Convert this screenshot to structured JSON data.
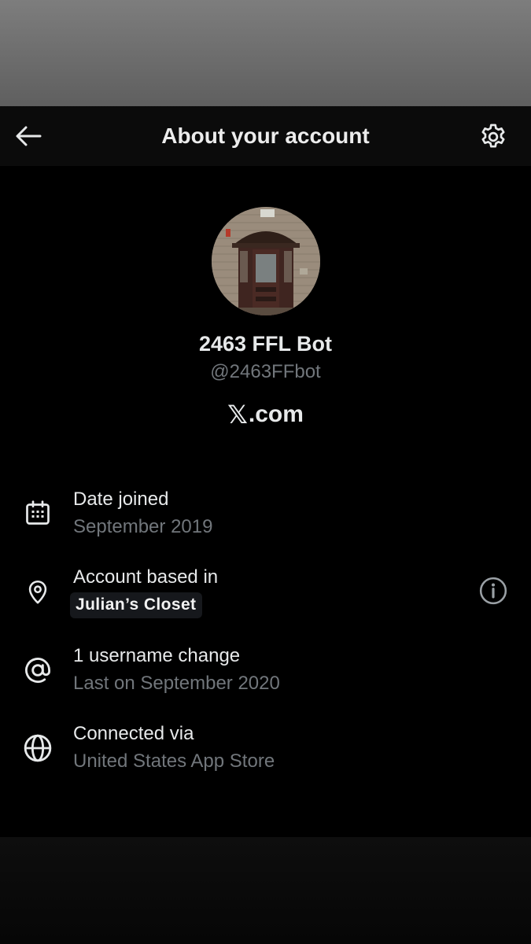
{
  "header": {
    "title": "About your account",
    "back_icon": "arrow-left-icon",
    "settings_icon": "gear-icon"
  },
  "profile": {
    "display_name": "2463 FFL Bot",
    "handle": "@2463FFbot",
    "site_suffix": ".com",
    "site_logo": "x-logo-icon"
  },
  "details": {
    "date_joined": {
      "label": "Date joined",
      "value": "September 2019",
      "icon": "calendar-icon"
    },
    "account_based": {
      "label": "Account based in",
      "value": "Julian’s Closet",
      "icon": "location-pin-icon",
      "info_icon": "info-icon"
    },
    "username_change": {
      "label": "1 username change",
      "value": "Last on September 2020",
      "icon": "at-sign-icon"
    },
    "connected_via": {
      "label": "Connected via",
      "value": "United States App Store",
      "icon": "globe-icon"
    }
  },
  "colors": {
    "background": "#000000",
    "primary_text": "#e7e9ea",
    "secondary_text": "#71767b"
  }
}
